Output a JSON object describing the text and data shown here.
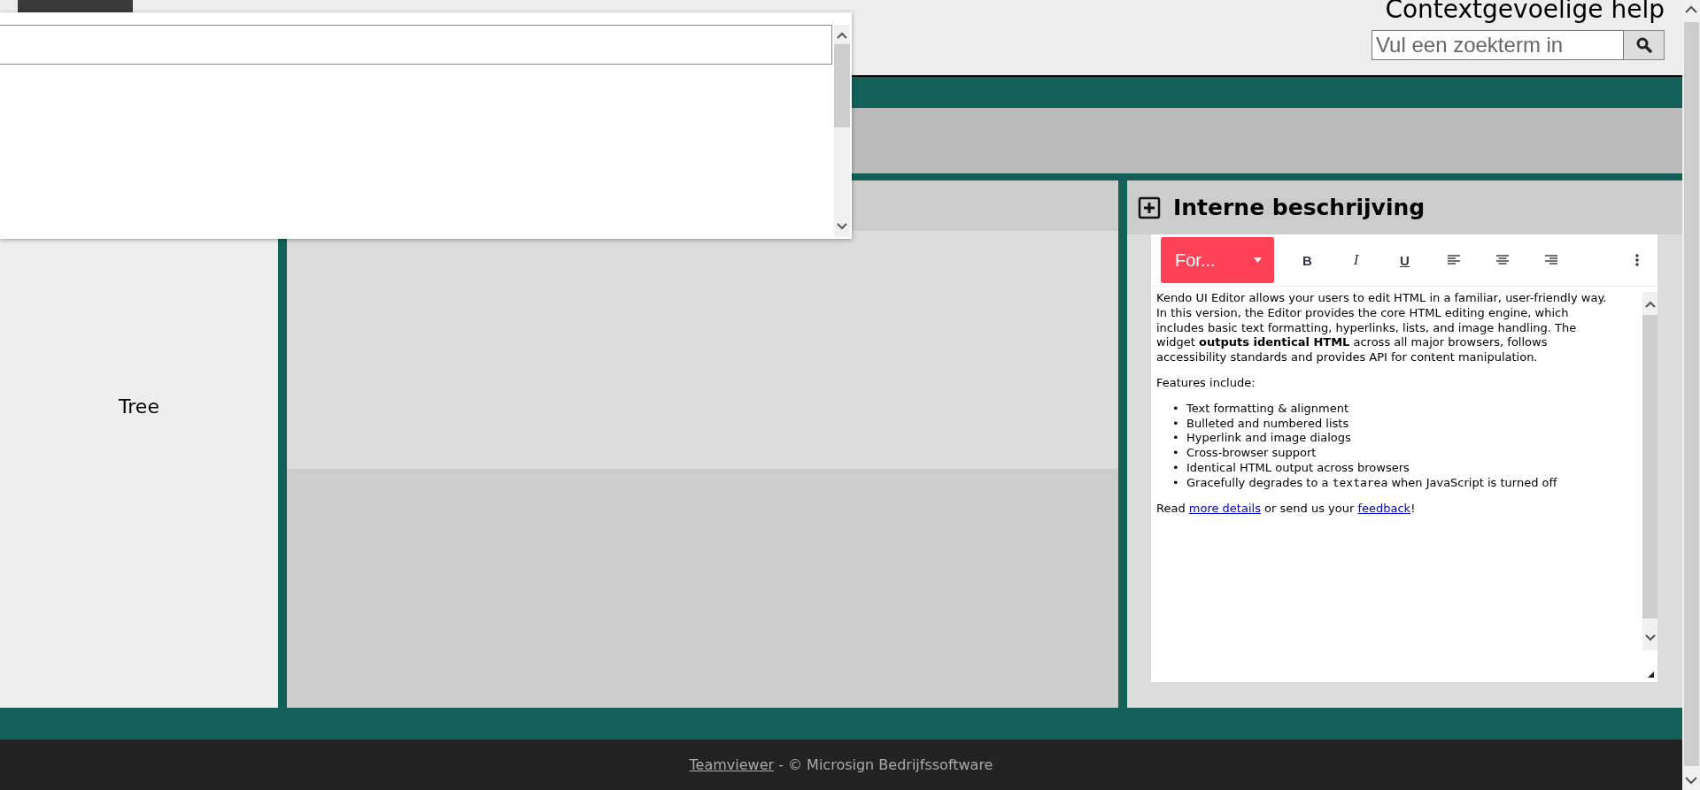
{
  "header": {
    "title": "Contextgevoelige help",
    "search": {
      "placeholder": "Vul een zoekterm in"
    }
  },
  "tree_panel": {
    "label": "Tree"
  },
  "description_panel": {
    "title": "Interne beschrijving"
  },
  "editor": {
    "format_button": "For...",
    "toolbar": [
      {
        "kind": "bold",
        "label": "B"
      },
      {
        "kind": "italic",
        "label": "I"
      },
      {
        "kind": "underline",
        "label": "U"
      },
      {
        "kind": "align-left"
      },
      {
        "kind": "align-center"
      },
      {
        "kind": "align-right"
      }
    ],
    "lines": [
      "Kendo UI Editor allows your users to edit HTML in a familiar, user-friendly way.",
      "In this version, the Editor provides the core HTML editing engine, which includes basic text formatting, hyperlinks, lists, and image handling. The widget **outputs identical HTML** across all major browsers, follows accessibility standards and provides API for content manipulation."
    ],
    "features_intro": "Features include:",
    "features": [
      {
        "bullet": "•",
        "text": "Text formatting & alignment"
      },
      {
        "bullet": "•",
        "text": "Bulleted and numbered lists"
      },
      {
        "bullet": "•",
        "text": "Hyperlink and image dialogs"
      },
      {
        "bullet": "•",
        "text": "Cross-browser support"
      },
      {
        "bullet": "•",
        "text": "Identical HTML output across browsers"
      },
      {
        "bullet": "•",
        "text": "Gracefully degrades to a ",
        "code": "textarea",
        "after": " when JavaScript is turned off"
      }
    ],
    "closing": {
      "before": "Read ",
      "link1": "more details",
      "middle": " or send us your ",
      "link2": "feedback",
      "after": "!"
    }
  },
  "footer": {
    "link": "Teamviewer",
    "text": " - © Microsign Bedrijfssoftware"
  }
}
